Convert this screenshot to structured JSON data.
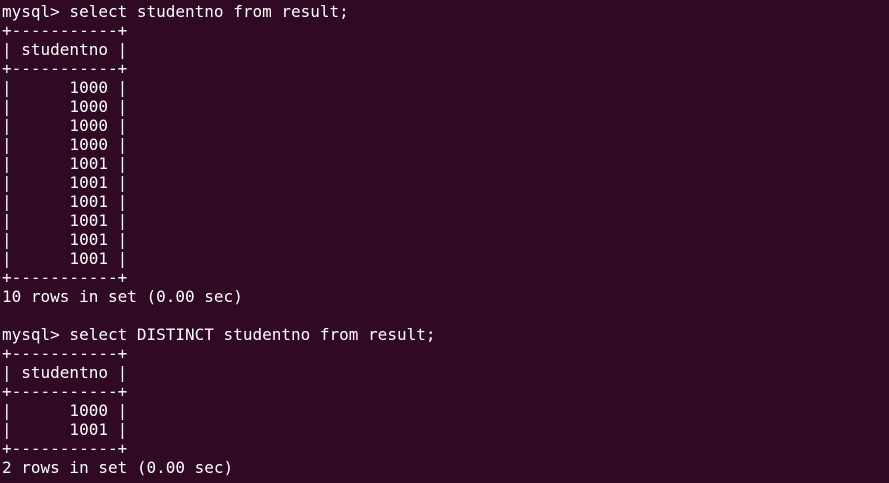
{
  "terminal": {
    "background": "#300a24",
    "foreground": "#ffffff",
    "lines": [
      "mysql> select studentno from result;",
      "+-----------+",
      "| studentno |",
      "+-----------+",
      "|      1000 |",
      "|      1000 |",
      "|      1000 |",
      "|      1000 |",
      "|      1001 |",
      "|      1001 |",
      "|      1001 |",
      "|      1001 |",
      "|      1001 |",
      "|      1001 |",
      "+-----------+",
      "10 rows in set (0.00 sec)",
      "",
      "mysql> select DISTINCT studentno from result;",
      "+-----------+",
      "| studentno |",
      "+-----------+",
      "|      1000 |",
      "|      1001 |",
      "+-----------+",
      "2 rows in set (0.00 sec)"
    ]
  }
}
